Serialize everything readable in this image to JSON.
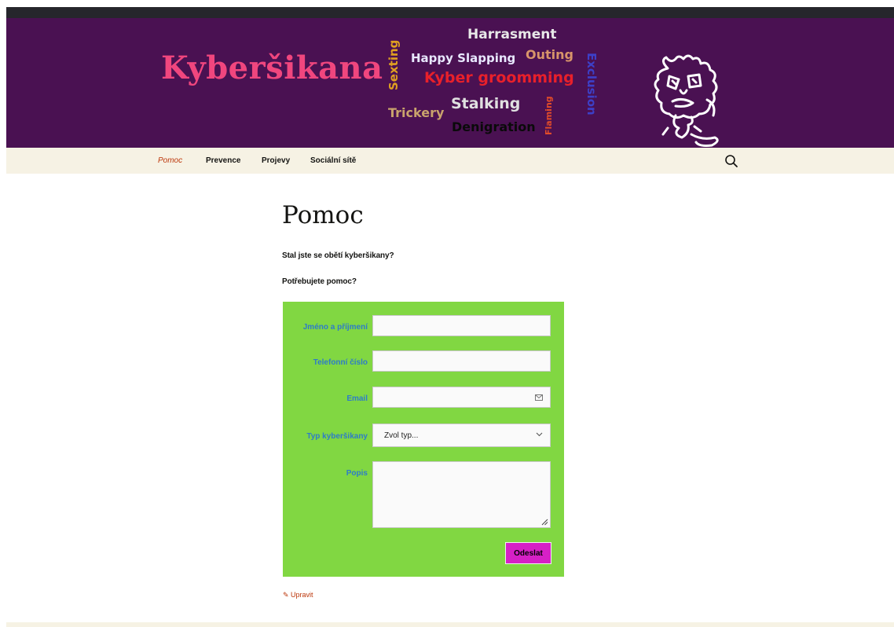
{
  "header": {
    "site_title": "Kyberšikana",
    "word_cloud": {
      "harrasment": "Harrasment",
      "happy_slapping": "Happy Slapping",
      "outing": "Outing",
      "kyber_grooming": "Kyber groomming",
      "stalking": "Stalking",
      "trickery": "Trickery",
      "denigration": "Denigration",
      "sexting": "Sexting",
      "exclusion": "Exclusion",
      "flaming": "Flaming"
    }
  },
  "nav": {
    "items": [
      {
        "label": "Pomoc",
        "active": true
      },
      {
        "label": "Prevence",
        "active": false
      },
      {
        "label": "Projevy",
        "active": false
      },
      {
        "label": "Sociální sítě",
        "active": false
      }
    ],
    "search_icon": "search-icon"
  },
  "content": {
    "title": "Pomoc",
    "paragraph1": "Stal jste se obětí kyberšikany?",
    "paragraph2": "Potřebujete pomoc?"
  },
  "form": {
    "name_label": "Jméno a příjmení",
    "name_value": "",
    "phone_label": "Telefonní číslo",
    "phone_value": "",
    "email_label": "Email",
    "email_value": "",
    "type_label": "Typ kyberšikany",
    "type_selected": "Zvol typ...",
    "description_label": "Popis",
    "description_value": "",
    "submit_label": "Odeslat",
    "background_color": "#81d742",
    "label_color": "#2e7cc8",
    "submit_color": "#d620c6"
  },
  "edit_link": "Upravit",
  "colors": {
    "header_bg": "#4a1152",
    "nav_bg": "#f6f2e4",
    "title_pink": "#f0467e",
    "active_nav": "#bc360a"
  }
}
